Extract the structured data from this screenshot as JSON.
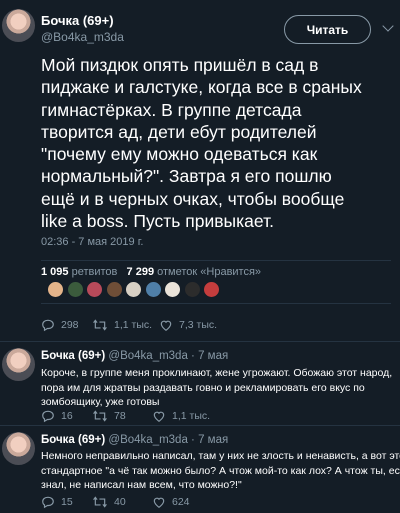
{
  "tweet": {
    "author_name": "Бочка (69+)",
    "author_handle": "@Bo4ka_m3da",
    "follow_label": "Читать",
    "text_lines": [
      "Мой пиздюк опять пришёл в сад в",
      "пиджаке и галстуке, когда все в сраных",
      "гимнастёрках. В группе детсада",
      "творится ад, дети ебут родителей",
      "\"почему ему можно одеваться как",
      "нормальный?\". Завтра я его пошлю",
      "ещё и в черных очках, чтобы вообще",
      "like a boss. Пусть привыкает."
    ],
    "timestamp": "02:36 - 7 мая 2019 г.",
    "retweets_count": "1 095",
    "retweets_label": "ретвитов",
    "likes_count": "7 299",
    "likes_label": "отметок «Нравится»",
    "likers": [
      "liker-1",
      "liker-2",
      "liker-3",
      "liker-4",
      "liker-5",
      "liker-6",
      "liker-7",
      "liker-8",
      "liker-9"
    ],
    "liker_colors": [
      "#e4b48a",
      "#3b5b3c",
      "#b84a5a",
      "#6f4e37",
      "#d8d0c4",
      "#4f7fa8",
      "#eae3d9",
      "#2c2c2c",
      "#c43d3d"
    ],
    "actions": {
      "replies": "298",
      "retweets": "1,1 тыс.",
      "likes": "7,3 тыс."
    }
  },
  "replies": [
    {
      "name": "Бочка (69+)",
      "meta": "@Bo4ka_m3da · 7 мая",
      "lines": [
        "Короче, в группе меня проклинают, жене угрожают. Обожаю этот народ,",
        "пора им для жратвы раздавать говно и рекламировать его вкус по",
        "зомбоящику, уже готовы"
      ],
      "actions": {
        "replies": "16",
        "retweets": "78",
        "likes": "1,1 тыс."
      }
    },
    {
      "name": "Бочка (69+)",
      "meta": "@Bo4ka_m3da · 7 мая",
      "lines": [
        "Немного неправильно написал, там у них не злость и ненависть, а вот это",
        "стандартное \"а чё так можно было? А чтож мой-то как лох? А чтож ты, если",
        "знал, не написал нам всем, что можно?!\""
      ],
      "actions": {
        "replies": "15",
        "retweets": "40",
        "likes": "624"
      }
    }
  ],
  "icons": {
    "reply": "reply-icon",
    "retweet": "retweet-icon",
    "like": "heart-icon",
    "more": "chevron-down-icon"
  },
  "colors": {
    "background": "#141d26",
    "text_secondary": "#8899a6",
    "border": "#253341"
  }
}
